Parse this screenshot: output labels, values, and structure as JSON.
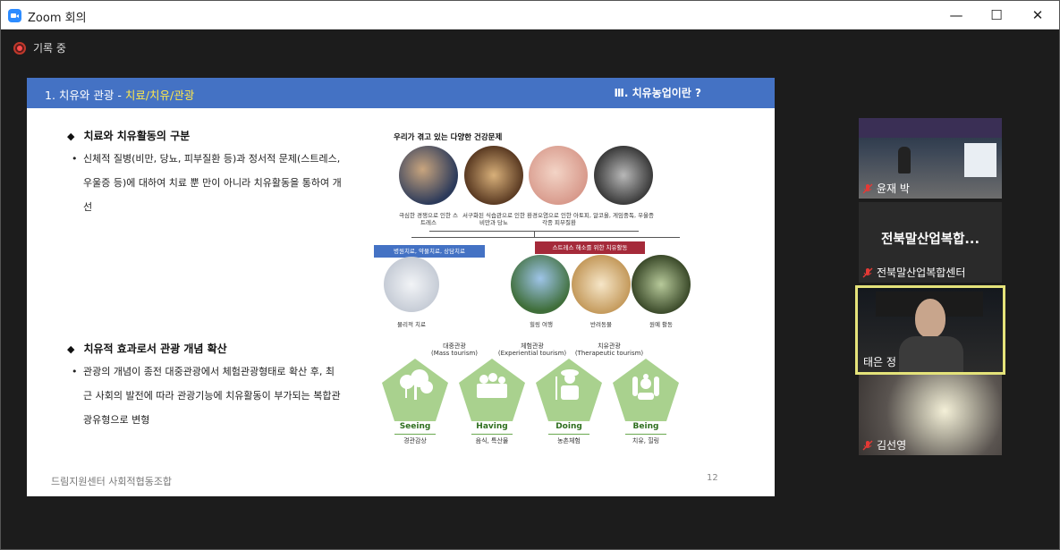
{
  "window": {
    "title": "Zoom 회의",
    "min_glyph": "—",
    "max_glyph": "☐",
    "close_glyph": "✕"
  },
  "recording": {
    "label": "기록 중"
  },
  "slide": {
    "header_left_plain": "1. 치유와 관광 - ",
    "header_left_highlight": "치료/치유/관광",
    "header_right": "Ⅲ. 치유농업이란 ?",
    "section1": {
      "title": "치료와 치유활동의 구분",
      "body": "신체적 질병(비만, 당뇨, 피부질환 등)과 정서적 문제(스트레스, 우울증 등)에 대하여 치료 뿐 만이 아니라 치유활동을 통하여 개선"
    },
    "section2": {
      "title": "치유적 효과로서 관광 개념 확산",
      "body": "관광의 개념이 종전 대중관광에서 체험관광형태로 확산 후, 최근 사회의 발전에 따라 관광기능에 치유활동이 부가되는 복합관광유형으로 변형"
    },
    "diagram": {
      "title": "우리가 겪고 있는 다양한 건강문제",
      "problems": [
        "극심한 경쟁으로 인한 스트레스",
        "서구화된 식습관으로 인한 비만과 당뇨",
        "환경오염으로 인한 아토피, 각종 피부질환",
        "알코올, 게임중독, 우울증"
      ],
      "tag_left": "병원치료, 약물치료, 상담치료",
      "tag_right": "스트레스 해소를 위한 치유활동",
      "left_item": "물리적 치료",
      "right_items": [
        "힐링 여행",
        "반려동물",
        "원예 활동"
      ],
      "tourism": [
        {
          "kr": "대중관광",
          "en": "(Mass tourism)"
        },
        {
          "kr": "체험관광",
          "en": "(Experiential tourism)"
        },
        {
          "kr": "치유관광",
          "en": "(Therapeutic tourism)"
        }
      ],
      "pentagons": [
        {
          "word": "Seeing",
          "sub": "경관감상"
        },
        {
          "word": "Having",
          "sub": "음식, 특산물"
        },
        {
          "word": "Doing",
          "sub": "농촌체험"
        },
        {
          "word": "Being",
          "sub": "치유, 힐링"
        }
      ]
    },
    "footer": "드림지원센터 사회적협동조합",
    "page_number": "12"
  },
  "participants": [
    {
      "name": "윤재 박",
      "muted": true
    },
    {
      "name": "전북말산업복합센터",
      "display": "전북말산업복합...",
      "muted": true
    },
    {
      "name": "태은 정",
      "muted": false,
      "active": true
    },
    {
      "name": "김선영",
      "muted": true
    }
  ],
  "colors": {
    "slide_header": "#4472c4",
    "highlight": "#ffe84a",
    "pentagon": "#a9d18e",
    "active_border": "#e5e37a"
  }
}
